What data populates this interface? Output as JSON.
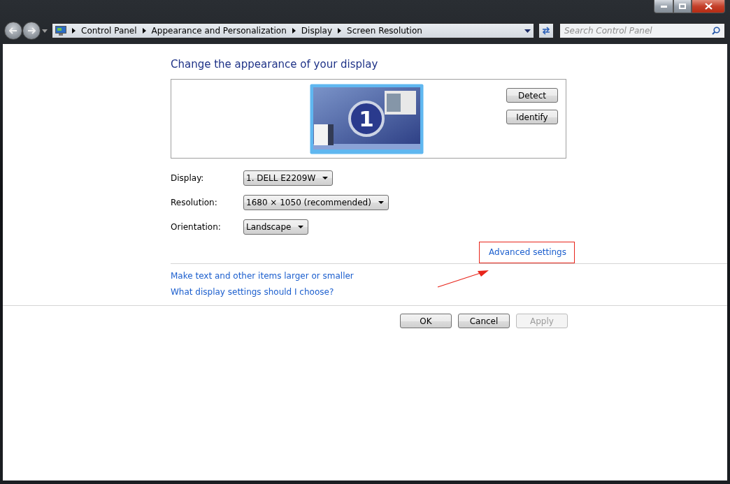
{
  "address": {
    "crumbs": [
      "Control Panel",
      "Appearance and Personalization",
      "Display",
      "Screen Resolution"
    ],
    "search_placeholder": "Search Control Panel"
  },
  "heading": "Change the appearance of your display",
  "monitors": [
    {
      "number": "1",
      "selected": true
    }
  ],
  "panel_buttons": [
    "Detect",
    "Identify"
  ],
  "fields": [
    {
      "label": "Display:",
      "value": "1. DELL E2209W"
    },
    {
      "label": "Resolution:",
      "value": "1680 × 1050 (recommended)"
    },
    {
      "label": "Orientation:",
      "value": "Landscape"
    }
  ],
  "advanced_link": {
    "text": "Advanced settings",
    "highlighted": true
  },
  "links": [
    "Make text and other items larger or smaller",
    "What display settings should I choose?"
  ],
  "dialog_buttons": [
    {
      "label": "OK",
      "disabled": false
    },
    {
      "label": "Cancel",
      "disabled": false
    },
    {
      "label": "Apply",
      "disabled": true
    }
  ]
}
